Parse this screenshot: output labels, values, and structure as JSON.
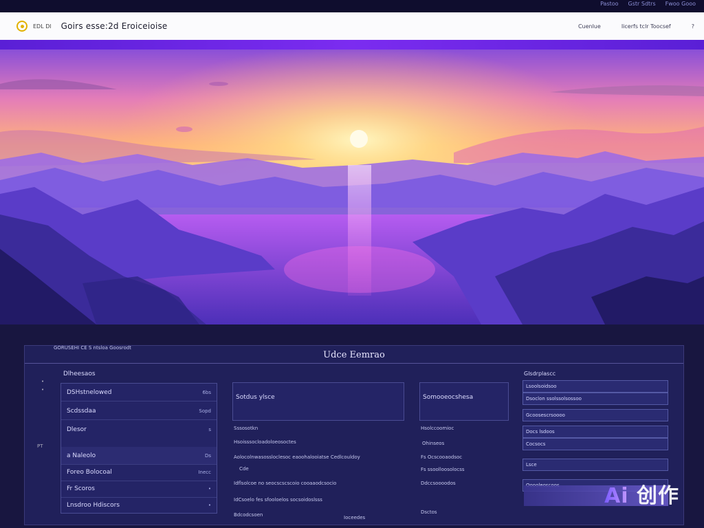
{
  "topbar": {
    "links": [
      "Pastoo",
      "Gstr  Sdtrs",
      "Fwoo  Gooo"
    ]
  },
  "header": {
    "logo_text": "EDL Dl",
    "title": "Goirs esse:2d Eroiceioise",
    "nav": [
      "Cuenlue",
      "Iicerfs tclr Toocsef"
    ],
    "help_glyph": "?"
  },
  "panel": {
    "crumb": "GORUSEHI CE S ntsloa Goosrodt",
    "title": "Udce Eemrao",
    "side_marks": [
      "•",
      "•",
      "PT"
    ],
    "col1": {
      "heading": "Dlheesaos",
      "rows": [
        {
          "label": "DSHstnelowed",
          "value": "6bs"
        },
        {
          "label": "Scdssdaa",
          "value": "Sopd"
        },
        {
          "label": "Dlesor",
          "value": "s"
        },
        {
          "label": "a Naleolo",
          "value": "Ds"
        },
        {
          "label": "Foreo Bolocoal",
          "value": "Inecc"
        },
        {
          "label": "Fr Scoros",
          "value": "•"
        },
        {
          "label": "Lnsdroo Hdiscors",
          "value": "•"
        }
      ]
    },
    "col2": {
      "box_label": "Sotdus ylsce",
      "lines": [
        "Sssosotkn",
        "Hsoisssocloadoloeosoctes",
        "Aolocolnwasossloclesoc eaoohalooiatse Cedlcouldoy",
        "Cde",
        "Idflsolcoe no seocscscscoio cooaaodcsocio",
        "IdCsoelo fes sfooloelos  socsoidoslsss",
        "Bdcodcsoen"
      ],
      "tail": "Ioceedes"
    },
    "col3": {
      "box_label": "Somooeocshesa",
      "lines": [
        "Hsolccoomioc",
        "Ohinseos",
        "Fs  Ocscooaodsoc",
        "Fs ssoolloosolocss",
        "Ddccsoooodos",
        "Dsctos"
      ]
    },
    "col4": {
      "heading": "Glsdrplascc",
      "fields": [
        "Lsoolsoidsoo",
        "Dsoclon ssolssolsossoo",
        "Gcoosescrsoooo",
        "Docs lsdoos",
        "Cocsocs",
        "Lsce",
        "Ooooleoscoos"
      ]
    }
  },
  "watermark": {
    "ai": "Ai",
    "cn": "创作"
  },
  "colors": {
    "header_bg": "#fbfbfd",
    "accent_bar": "#6a25e8",
    "panel_bg": "#20205a",
    "sky_top": "#6f3fd0",
    "sun": "#fffbe0"
  }
}
